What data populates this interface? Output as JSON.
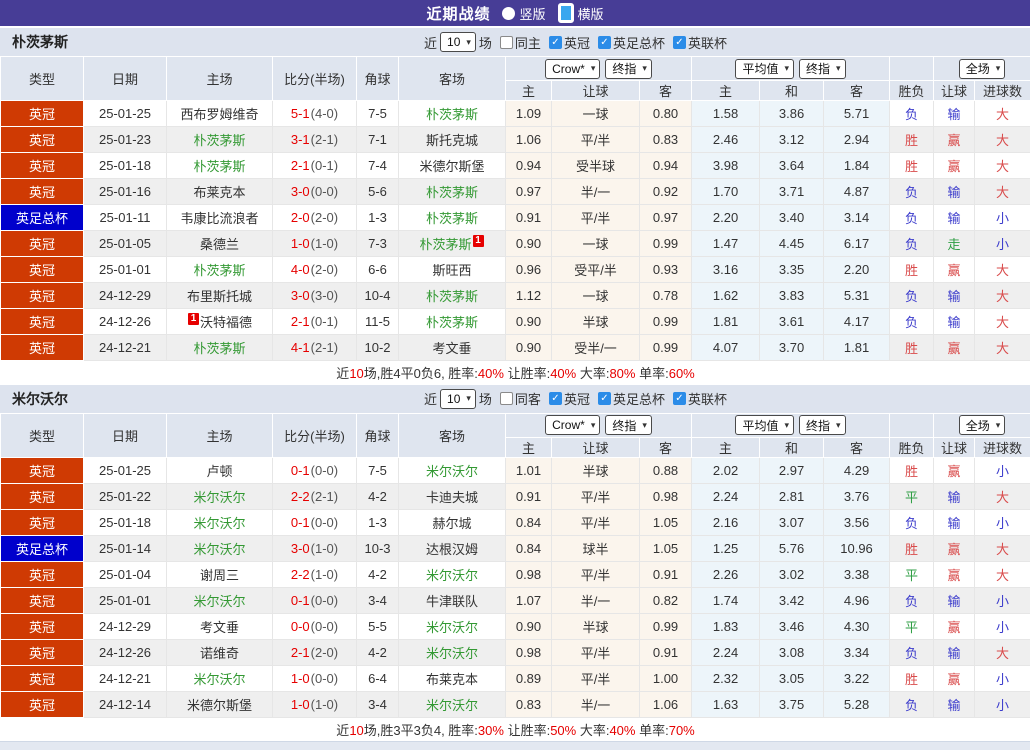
{
  "title": {
    "text": "近期战绩"
  },
  "view_modes": [
    {
      "label": "竖版",
      "selected": false
    },
    {
      "label": "横版",
      "selected": true
    }
  ],
  "filter": {
    "near": "近",
    "count": "10",
    "games": "场",
    "leagues": [
      "英冠",
      "英足总杯",
      "英联杯"
    ]
  },
  "dropdowns": {
    "odds_company": "Crow*",
    "odds_stage": "终指",
    "euro_company": "平均值",
    "euro_stage": "终指",
    "scope": "全场"
  },
  "columns": {
    "type": "类型",
    "date": "日期",
    "home": "主场",
    "score": "比分(半场)",
    "corner": "角球",
    "away": "客场",
    "host": "主",
    "handicap": "让球",
    "guest": "客",
    "draw": "和",
    "outcome": "胜负",
    "outcome_handicap": "让球",
    "goals": "进球数"
  },
  "league_colors": {
    "英冠": "#cf3a03",
    "英足总杯": "#0000cc"
  },
  "outcome_colors": {
    "胜": "#d94b4b",
    "赢": "#d94b4b",
    "大": "#d94b4b",
    "平": "#2e9e43",
    "走": "#2e9e43",
    "负": "#3c3ccc",
    "输": "#3c3ccc",
    "小": "#3c3ccc"
  },
  "sections": [
    {
      "team": "朴茨茅斯",
      "same": "同主",
      "rows": [
        {
          "league": "英冠",
          "date": "25-01-25",
          "home": "西布罗姆维奇",
          "homeGreen": false,
          "score": "5-1",
          "half": "(4-0)",
          "corner": "7-5",
          "away": "朴茨茅斯",
          "awayGreen": true,
          "asian": [
            "1.09",
            "一球",
            "0.80"
          ],
          "euro": [
            "1.58",
            "3.86",
            "5.71"
          ],
          "outcome": [
            "负",
            "输",
            "大"
          ]
        },
        {
          "league": "英冠",
          "date": "25-01-23",
          "home": "朴茨茅斯",
          "homeGreen": true,
          "score": "3-1",
          "half": "(2-1)",
          "corner": "7-1",
          "away": "斯托克城",
          "awayGreen": false,
          "asian": [
            "1.06",
            "平/半",
            "0.83"
          ],
          "euro": [
            "2.46",
            "3.12",
            "2.94"
          ],
          "outcome": [
            "胜",
            "赢",
            "大"
          ]
        },
        {
          "league": "英冠",
          "date": "25-01-18",
          "home": "朴茨茅斯",
          "homeGreen": true,
          "score": "2-1",
          "half": "(0-1)",
          "corner": "7-4",
          "away": "米德尔斯堡",
          "awayGreen": false,
          "asian": [
            "0.94",
            "受半球",
            "0.94"
          ],
          "euro": [
            "3.98",
            "3.64",
            "1.84"
          ],
          "outcome": [
            "胜",
            "赢",
            "大"
          ]
        },
        {
          "league": "英冠",
          "date": "25-01-16",
          "home": "布莱克本",
          "homeGreen": false,
          "score": "3-0",
          "half": "(0-0)",
          "corner": "5-6",
          "away": "朴茨茅斯",
          "awayGreen": true,
          "asian": [
            "0.97",
            "半/一",
            "0.92"
          ],
          "euro": [
            "1.70",
            "3.71",
            "4.87"
          ],
          "outcome": [
            "负",
            "输",
            "大"
          ]
        },
        {
          "league": "英足总杯",
          "date": "25-01-11",
          "home": "韦康比流浪者",
          "homeGreen": false,
          "score": "2-0",
          "half": "(2-0)",
          "corner": "1-3",
          "away": "朴茨茅斯",
          "awayGreen": true,
          "asian": [
            "0.91",
            "平/半",
            "0.97"
          ],
          "euro": [
            "2.20",
            "3.40",
            "3.14"
          ],
          "outcome": [
            "负",
            "输",
            "小"
          ]
        },
        {
          "league": "英冠",
          "date": "25-01-05",
          "home": "桑德兰",
          "homeGreen": false,
          "score": "1-0",
          "half": "(1-0)",
          "corner": "7-3",
          "away": "朴茨茅斯",
          "awayGreen": true,
          "awayCard": true,
          "asian": [
            "0.90",
            "一球",
            "0.99"
          ],
          "euro": [
            "1.47",
            "4.45",
            "6.17"
          ],
          "outcome": [
            "负",
            "走",
            "小"
          ]
        },
        {
          "league": "英冠",
          "date": "25-01-01",
          "home": "朴茨茅斯",
          "homeGreen": true,
          "score": "4-0",
          "half": "(2-0)",
          "corner": "6-6",
          "away": "斯旺西",
          "awayGreen": false,
          "asian": [
            "0.96",
            "受平/半",
            "0.93"
          ],
          "euro": [
            "3.16",
            "3.35",
            "2.20"
          ],
          "outcome": [
            "胜",
            "赢",
            "大"
          ]
        },
        {
          "league": "英冠",
          "date": "24-12-29",
          "home": "布里斯托城",
          "homeGreen": false,
          "score": "3-0",
          "half": "(3-0)",
          "corner": "10-4",
          "away": "朴茨茅斯",
          "awayGreen": true,
          "asian": [
            "1.12",
            "一球",
            "0.78"
          ],
          "euro": [
            "1.62",
            "3.83",
            "5.31"
          ],
          "outcome": [
            "负",
            "输",
            "大"
          ]
        },
        {
          "league": "英冠",
          "date": "24-12-26",
          "home": "沃特福德",
          "homeGreen": false,
          "homeCard": true,
          "score": "2-1",
          "half": "(0-1)",
          "corner": "11-5",
          "away": "朴茨茅斯",
          "awayGreen": true,
          "asian": [
            "0.90",
            "半球",
            "0.99"
          ],
          "euro": [
            "1.81",
            "3.61",
            "4.17"
          ],
          "outcome": [
            "负",
            "输",
            "大"
          ]
        },
        {
          "league": "英冠",
          "date": "24-12-21",
          "home": "朴茨茅斯",
          "homeGreen": true,
          "score": "4-1",
          "half": "(2-1)",
          "corner": "10-2",
          "away": "考文垂",
          "awayGreen": false,
          "asian": [
            "0.90",
            "受半/一",
            "0.99"
          ],
          "euro": [
            "4.07",
            "3.70",
            "1.81"
          ],
          "outcome": [
            "胜",
            "赢",
            "大"
          ]
        }
      ],
      "summary": [
        {
          "text": "近",
          "red": false
        },
        {
          "text": "10",
          "red": true
        },
        {
          "text": "场,胜4平0负6, 胜率:",
          "red": false
        },
        {
          "text": "40%",
          "red": true
        },
        {
          "text": " 让胜率:",
          "red": false
        },
        {
          "text": "40%",
          "red": true
        },
        {
          "text": " 大率:",
          "red": false
        },
        {
          "text": "80%",
          "red": true
        },
        {
          "text": " 单率:",
          "red": false
        },
        {
          "text": "60%",
          "red": true
        }
      ]
    },
    {
      "team": "米尔沃尔",
      "same": "同客",
      "rows": [
        {
          "league": "英冠",
          "date": "25-01-25",
          "home": "卢顿",
          "homeGreen": false,
          "score": "0-1",
          "half": "(0-0)",
          "corner": "7-5",
          "away": "米尔沃尔",
          "awayGreen": true,
          "asian": [
            "1.01",
            "半球",
            "0.88"
          ],
          "euro": [
            "2.02",
            "2.97",
            "4.29"
          ],
          "outcome": [
            "胜",
            "赢",
            "小"
          ]
        },
        {
          "league": "英冠",
          "date": "25-01-22",
          "home": "米尔沃尔",
          "homeGreen": true,
          "score": "2-2",
          "half": "(2-1)",
          "corner": "4-2",
          "away": "卡迪夫城",
          "awayGreen": false,
          "asian": [
            "0.91",
            "平/半",
            "0.98"
          ],
          "euro": [
            "2.24",
            "2.81",
            "3.76"
          ],
          "outcome": [
            "平",
            "输",
            "大"
          ]
        },
        {
          "league": "英冠",
          "date": "25-01-18",
          "home": "米尔沃尔",
          "homeGreen": true,
          "score": "0-1",
          "half": "(0-0)",
          "corner": "1-3",
          "away": "赫尔城",
          "awayGreen": false,
          "asian": [
            "0.84",
            "平/半",
            "1.05"
          ],
          "euro": [
            "2.16",
            "3.07",
            "3.56"
          ],
          "outcome": [
            "负",
            "输",
            "小"
          ]
        },
        {
          "league": "英足总杯",
          "date": "25-01-14",
          "home": "米尔沃尔",
          "homeGreen": true,
          "score": "3-0",
          "half": "(1-0)",
          "corner": "10-3",
          "away": "达根汉姆",
          "awayGreen": false,
          "asian": [
            "0.84",
            "球半",
            "1.05"
          ],
          "euro": [
            "1.25",
            "5.76",
            "10.96"
          ],
          "outcome": [
            "胜",
            "赢",
            "大"
          ]
        },
        {
          "league": "英冠",
          "date": "25-01-04",
          "home": "谢周三",
          "homeGreen": false,
          "score": "2-2",
          "half": "(1-0)",
          "corner": "4-2",
          "away": "米尔沃尔",
          "awayGreen": true,
          "asian": [
            "0.98",
            "平/半",
            "0.91"
          ],
          "euro": [
            "2.26",
            "3.02",
            "3.38"
          ],
          "outcome": [
            "平",
            "赢",
            "大"
          ]
        },
        {
          "league": "英冠",
          "date": "25-01-01",
          "home": "米尔沃尔",
          "homeGreen": true,
          "score": "0-1",
          "half": "(0-0)",
          "corner": "3-4",
          "away": "牛津联队",
          "awayGreen": false,
          "asian": [
            "1.07",
            "半/一",
            "0.82"
          ],
          "euro": [
            "1.74",
            "3.42",
            "4.96"
          ],
          "outcome": [
            "负",
            "输",
            "小"
          ]
        },
        {
          "league": "英冠",
          "date": "24-12-29",
          "home": "考文垂",
          "homeGreen": false,
          "score": "0-0",
          "half": "(0-0)",
          "corner": "5-5",
          "away": "米尔沃尔",
          "awayGreen": true,
          "asian": [
            "0.90",
            "半球",
            "0.99"
          ],
          "euro": [
            "1.83",
            "3.46",
            "4.30"
          ],
          "outcome": [
            "平",
            "赢",
            "小"
          ]
        },
        {
          "league": "英冠",
          "date": "24-12-26",
          "home": "诺维奇",
          "homeGreen": false,
          "score": "2-1",
          "half": "(2-0)",
          "corner": "4-2",
          "away": "米尔沃尔",
          "awayGreen": true,
          "asian": [
            "0.98",
            "平/半",
            "0.91"
          ],
          "euro": [
            "2.24",
            "3.08",
            "3.34"
          ],
          "outcome": [
            "负",
            "输",
            "大"
          ]
        },
        {
          "league": "英冠",
          "date": "24-12-21",
          "home": "米尔沃尔",
          "homeGreen": true,
          "score": "1-0",
          "half": "(0-0)",
          "corner": "6-4",
          "away": "布莱克本",
          "awayGreen": false,
          "asian": [
            "0.89",
            "平/半",
            "1.00"
          ],
          "euro": [
            "2.32",
            "3.05",
            "3.22"
          ],
          "outcome": [
            "胜",
            "赢",
            "小"
          ]
        },
        {
          "league": "英冠",
          "date": "24-12-14",
          "home": "米德尔斯堡",
          "homeGreen": false,
          "score": "1-0",
          "half": "(1-0)",
          "corner": "3-4",
          "away": "米尔沃尔",
          "awayGreen": true,
          "asian": [
            "0.83",
            "半/一",
            "1.06"
          ],
          "euro": [
            "1.63",
            "3.75",
            "5.28"
          ],
          "outcome": [
            "负",
            "输",
            "小"
          ]
        }
      ],
      "summary": [
        {
          "text": "近",
          "red": false
        },
        {
          "text": "10",
          "red": true
        },
        {
          "text": "场,胜3平3负4, 胜率:",
          "red": false
        },
        {
          "text": "30%",
          "red": true
        },
        {
          "text": " 让胜率:",
          "red": false
        },
        {
          "text": "50%",
          "red": true
        },
        {
          "text": " 大率:",
          "red": false
        },
        {
          "text": "40%",
          "red": true
        },
        {
          "text": " 单率:",
          "red": false
        },
        {
          "text": "70%",
          "red": true
        }
      ]
    }
  ]
}
